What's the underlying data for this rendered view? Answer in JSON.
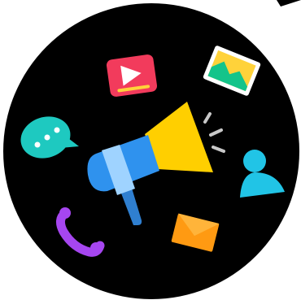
{
  "scene": {
    "description_icons": [
      "megaphone-icon",
      "video-play-icon",
      "photo-icon",
      "chat-bubble-icon",
      "user-icon",
      "phone-icon",
      "envelope-icon",
      "sound-lines-icon"
    ]
  },
  "colors": {
    "background": "#ffffff",
    "circle": "#000000",
    "corner_mark": "#000000",
    "megaphone_cone": "#ffcf00",
    "megaphone_body": "#2f92ee",
    "megaphone_band": "#9fd3ff",
    "megaphone_handle": "#2f7fd0",
    "video_bg": "#f23b5c",
    "video_play": "#ffffff",
    "video_underline": "#ffd23a",
    "photo_frame": "#ffffff",
    "photo_sky": "#ffd23a",
    "photo_hill": "#14c48a",
    "chat_bubble": "#1ec9c0",
    "chat_dots": "#ffffff",
    "user": "#21c4e6",
    "phone": "#a646f0",
    "envelope": "#ff9a12",
    "envelope_flap": "#ffb43a",
    "sound_lines": "#c8c8c8"
  }
}
